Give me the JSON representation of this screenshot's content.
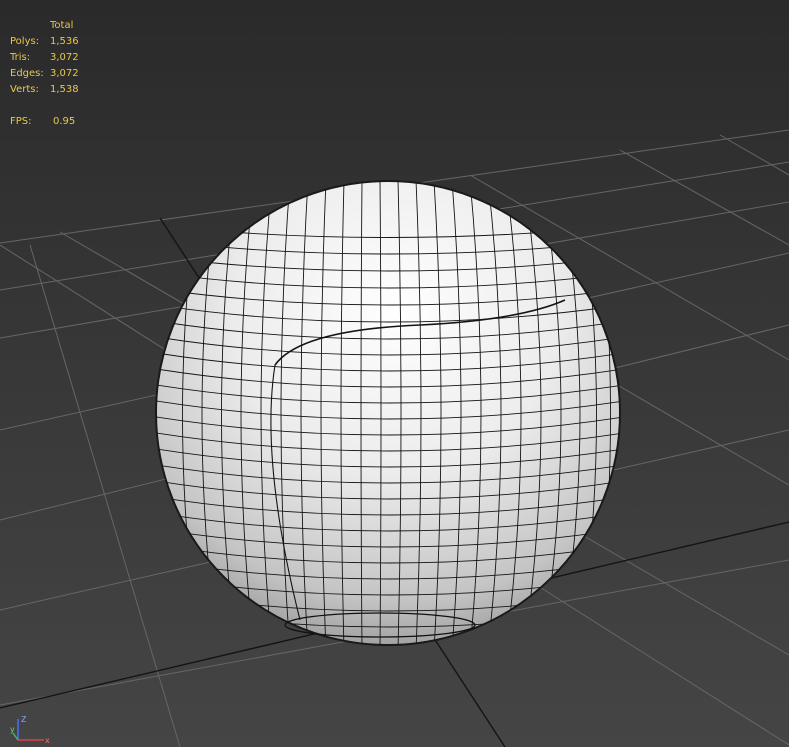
{
  "viewport": {
    "stats": {
      "header": "Total",
      "rows": [
        {
          "label": "Polys:",
          "value": "1,536"
        },
        {
          "label": "Tris:",
          "value": "3,072"
        },
        {
          "label": "Edges:",
          "value": "3,072"
        },
        {
          "label": "Verts:",
          "value": "1,538"
        }
      ],
      "fps_label": "FPS:",
      "fps_value": "0.95"
    },
    "axis_tripod": {
      "z": "Z",
      "y": "y",
      "x": "x"
    },
    "colors": {
      "stats_text": "#e9c74a",
      "grid_line": "#6a6a6a",
      "sphere_light": "#ffffff",
      "sphere_shadow": "#8f8f8f",
      "wire": "#111111"
    },
    "object": {
      "type": "sphere",
      "shading": "smooth + wireframe edged faces"
    }
  }
}
